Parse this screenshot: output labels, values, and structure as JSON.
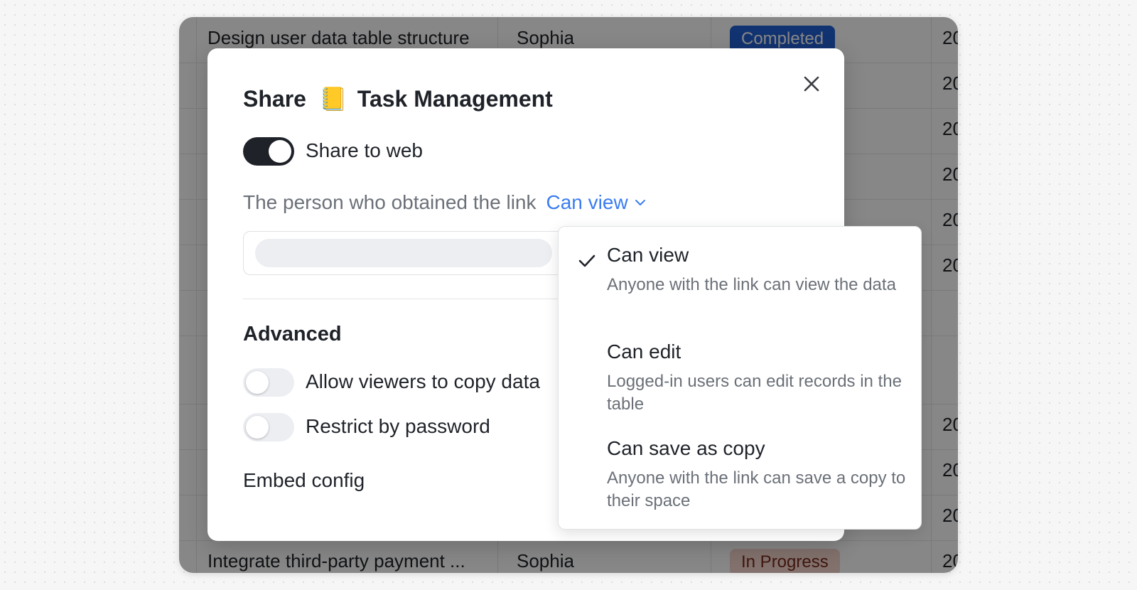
{
  "background_table": {
    "rows": [
      {
        "task": "Design user data table structure",
        "assignee": "Sophia",
        "status": "Completed",
        "date": "20"
      },
      {
        "task": "",
        "assignee": "",
        "status": "",
        "date": "20"
      },
      {
        "task": "",
        "assignee": "",
        "status": "",
        "date": "20"
      },
      {
        "task": "",
        "assignee": "",
        "status": "",
        "date": "20"
      },
      {
        "task": "",
        "assignee": "",
        "status": "",
        "date": "20"
      },
      {
        "task": "",
        "assignee": "",
        "status": "",
        "date": "20"
      },
      {
        "task": "",
        "assignee": "",
        "status": "",
        "date": ""
      },
      {
        "task": "",
        "assignee": "",
        "status": "",
        "date": ""
      },
      {
        "task": "",
        "assignee": "",
        "status": "",
        "date": "20"
      },
      {
        "task": "",
        "assignee": "",
        "status": "",
        "date": "20"
      },
      {
        "task": "",
        "assignee": "",
        "status": "",
        "date": "20"
      },
      {
        "task": "Integrate third-party payment ...",
        "assignee": "Sophia",
        "status": "In Progress",
        "date": "20"
      }
    ]
  },
  "modal": {
    "title_prefix": "Share",
    "title_emoji": "📒",
    "title_name": "Task Management",
    "share_to_web": {
      "label": "Share to web",
      "enabled": true
    },
    "link_permission_prefix": "The person who obtained the link",
    "link_permission_value": "Can view",
    "advanced_heading": "Advanced",
    "allow_copy": {
      "label": "Allow viewers to copy data",
      "enabled": false
    },
    "restrict_password": {
      "label": "Restrict by password",
      "enabled": false
    },
    "embed_config_label": "Embed config"
  },
  "permission_menu": {
    "options": [
      {
        "title": "Can view",
        "description": "Anyone with the link can view the data",
        "selected": true
      },
      {
        "title": "Can edit",
        "description": "Logged-in users can edit records in the table",
        "selected": false
      },
      {
        "title": "Can save as copy",
        "description": "Anyone with the link can save a copy to their space",
        "selected": false
      }
    ]
  },
  "colors": {
    "accent": "#3b7cf0",
    "toggle_on": "#1f2329",
    "toggle_off": "#eceef2",
    "status_completed": "#2361d6",
    "status_in_progress": "#f6d5cf"
  }
}
